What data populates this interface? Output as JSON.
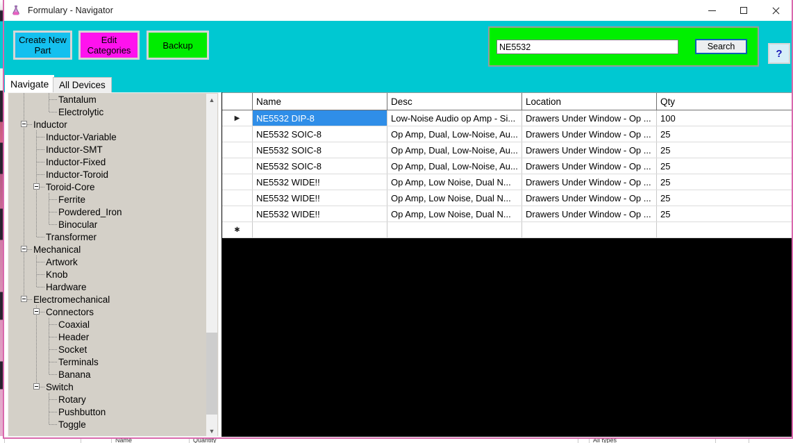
{
  "window": {
    "title": "Formulary - Navigator",
    "icon": "flask-icon",
    "minimize_label": "Minimize",
    "maximize_label": "Maximize",
    "close_label": "Close"
  },
  "toolbar": {
    "create_new_part": "Create New Part",
    "edit_categories": "Edit Categories",
    "backup": "Backup",
    "help": "?",
    "colors": {
      "background": "#00c8d2",
      "create_new_part": "#14c0ef",
      "edit_categories": "#ff12ee",
      "backup": "#00ed00",
      "search_panel": "#00f000",
      "help": "#d6eef8"
    }
  },
  "search": {
    "value": "NE5532",
    "placeholder": "",
    "button_label": "Search"
  },
  "tabs": [
    {
      "label": "Navigate",
      "active": true
    },
    {
      "label": "All Devices",
      "active": false
    }
  ],
  "tree": {
    "scroll_position": "middle",
    "nodes": [
      {
        "label": "Tantalum",
        "depth": 3,
        "expander": null,
        "last": false
      },
      {
        "label": "Electrolytic",
        "depth": 3,
        "expander": null,
        "last": true
      },
      {
        "label": "Inductor",
        "depth": 1,
        "expander": "minus",
        "last": false
      },
      {
        "label": "Inductor-Variable",
        "depth": 2,
        "expander": null,
        "last": false
      },
      {
        "label": "Inductor-SMT",
        "depth": 2,
        "expander": null,
        "last": false
      },
      {
        "label": "Inductor-Fixed",
        "depth": 2,
        "expander": null,
        "last": false
      },
      {
        "label": "Inductor-Toroid",
        "depth": 2,
        "expander": null,
        "last": false
      },
      {
        "label": "Toroid-Core",
        "depth": 2,
        "expander": "minus",
        "last": false
      },
      {
        "label": "Ferrite",
        "depth": 3,
        "expander": null,
        "last": false
      },
      {
        "label": "Powdered_Iron",
        "depth": 3,
        "expander": null,
        "last": false
      },
      {
        "label": "Binocular",
        "depth": 3,
        "expander": null,
        "last": true
      },
      {
        "label": "Transformer",
        "depth": 2,
        "expander": null,
        "last": true
      },
      {
        "label": "Mechanical",
        "depth": 1,
        "expander": "minus",
        "last": false
      },
      {
        "label": "Artwork",
        "depth": 2,
        "expander": null,
        "last": false
      },
      {
        "label": "Knob",
        "depth": 2,
        "expander": null,
        "last": false
      },
      {
        "label": "Hardware",
        "depth": 2,
        "expander": null,
        "last": true
      },
      {
        "label": "Electromechanical",
        "depth": 1,
        "expander": "minus",
        "last": false
      },
      {
        "label": "Connectors",
        "depth": 2,
        "expander": "minus",
        "last": false
      },
      {
        "label": "Coaxial",
        "depth": 3,
        "expander": null,
        "last": false
      },
      {
        "label": "Header",
        "depth": 3,
        "expander": null,
        "last": false
      },
      {
        "label": "Socket",
        "depth": 3,
        "expander": null,
        "last": false
      },
      {
        "label": "Terminals",
        "depth": 3,
        "expander": null,
        "last": false
      },
      {
        "label": "Banana",
        "depth": 3,
        "expander": null,
        "last": true
      },
      {
        "label": "Switch",
        "depth": 2,
        "expander": "minus",
        "last": false
      },
      {
        "label": "Rotary",
        "depth": 3,
        "expander": null,
        "last": false
      },
      {
        "label": "Pushbutton",
        "depth": 3,
        "expander": null,
        "last": false
      },
      {
        "label": "Toggle",
        "depth": 3,
        "expander": null,
        "last": false
      }
    ]
  },
  "grid": {
    "columns": [
      "",
      "Name",
      "Desc",
      "Location",
      "Qty"
    ],
    "current_row_marker": "▶",
    "new_row_marker": "✱",
    "rows": [
      {
        "marker": "▶",
        "selected": true,
        "Name": "NE5532 DIP-8",
        "Desc": "Low-Noise Audio op Amp - Si...",
        "Location": "Drawers Under Window - Op ...",
        "Qty": "100"
      },
      {
        "marker": "",
        "selected": false,
        "Name": "NE5532 SOIC-8",
        "Desc": "Op Amp, Dual, Low-Noise, Au...",
        "Location": "Drawers Under Window - Op ...",
        "Qty": "25"
      },
      {
        "marker": "",
        "selected": false,
        "Name": "NE5532 SOIC-8",
        "Desc": "Op Amp, Dual, Low-Noise, Au...",
        "Location": "Drawers Under Window - Op ...",
        "Qty": "25"
      },
      {
        "marker": "",
        "selected": false,
        "Name": "NE5532 SOIC-8",
        "Desc": "Op Amp, Dual, Low-Noise, Au...",
        "Location": "Drawers Under Window - Op ...",
        "Qty": "25"
      },
      {
        "marker": "",
        "selected": false,
        "Name": "NE5532 WIDE!!",
        "Desc": "Op Amp, Low Noise, Dual  N...",
        "Location": "Drawers Under Window - Op ...",
        "Qty": "25"
      },
      {
        "marker": "",
        "selected": false,
        "Name": "NE5532 WIDE!!",
        "Desc": "Op Amp, Low Noise, Dual  N...",
        "Location": "Drawers Under Window - Op ...",
        "Qty": "25"
      },
      {
        "marker": "",
        "selected": false,
        "Name": "NE5532 WIDE!!",
        "Desc": "Op Amp, Low Noise, Dual  N...",
        "Location": "Drawers Under Window - Op ...",
        "Qty": "25"
      },
      {
        "marker": "✱",
        "selected": false,
        "Name": "",
        "Desc": "",
        "Location": "",
        "Qty": ""
      }
    ]
  },
  "background_window": {
    "headers": [
      "Name",
      "Quantity",
      "All types"
    ]
  }
}
